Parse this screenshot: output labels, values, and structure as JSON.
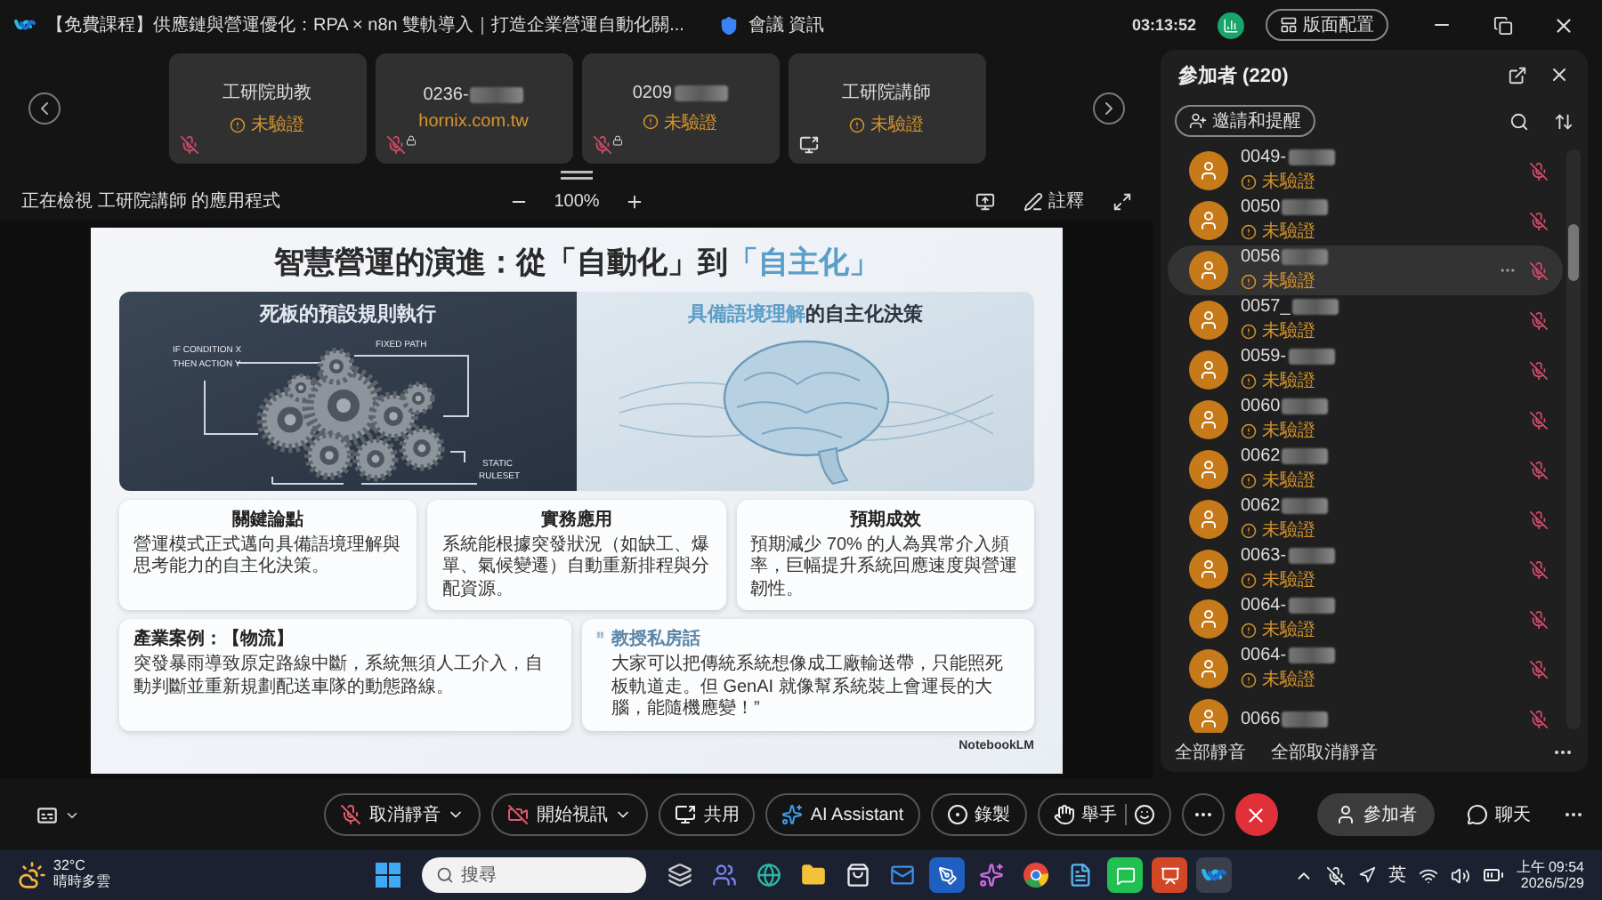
{
  "title_bar": {
    "title": "【免費課程】供應鏈與營運優化：RPA × n8n 雙軌導入｜打造企業營運自動化關...",
    "meeting_info": "會議 資訊",
    "timer": "03:13:52",
    "layout_button": "版面配置"
  },
  "video_tiles": [
    {
      "name": "工研院助教",
      "status": "未驗證",
      "blurred": false,
      "kind": "mic_off"
    },
    {
      "name": "0236-",
      "detail": "hornix.com.tw",
      "blurred": true,
      "kind": "mic_off_locked"
    },
    {
      "name": "0209",
      "status": "未驗證",
      "blurred": true,
      "kind": "mic_off_locked"
    },
    {
      "name": "工研院講師",
      "status": "未驗證",
      "blurred": false,
      "kind": "screen_share"
    }
  ],
  "share_bar": {
    "viewing": "正在檢視 工研院講師 的應用程式",
    "zoom": "100%",
    "annotate": "註釋"
  },
  "slide": {
    "title": "智慧營運的演進：從「自動化」到",
    "title_highlight": "「自主化」",
    "left_panel": {
      "heading": "死板的預設規則執行",
      "labels": [
        "IF CONDITION X",
        "THEN ACTION Y",
        "FIXED PATH",
        "STATIC",
        "RULESET"
      ]
    },
    "right_panel": {
      "heading_highlight": "具備語境理解",
      "heading_rest": "的自主化決策"
    },
    "cards": [
      {
        "title": "關鍵論點",
        "body": "營運模式正式邁向具備語境理解與思考能力的自主化決策。"
      },
      {
        "title": "實務應用",
        "body": "系統能根據突發狀況（如缺工、爆單、氣候變遷）自動重新排程與分配資源。"
      },
      {
        "title": "預期成效",
        "body": "預期減少 70% 的人為異常介入頻率，巨幅提升系統回應速度與營運韌性。"
      }
    ],
    "case": {
      "title": "產業案例：【物流】",
      "body": "突發暴雨導致原定路線中斷，系統無須人工介入，自動判斷並重新規劃配送車隊的動態路線。"
    },
    "quote": {
      "title": "教授私房話",
      "body": "大家可以把傳統系統想像成工廠輸送帶，只能照死板軌道走。但 GenAI 就像幫系統裝上會運長的大腦，能隨機應變！”"
    },
    "brand": "NotebookLM"
  },
  "participants_panel": {
    "title": "參加者 (220)",
    "invite_button": "邀請和提醒",
    "participants": [
      {
        "name": "0049-",
        "status": "未驗證",
        "selected": false,
        "blurred": true
      },
      {
        "name": "0050",
        "status": "未驗證",
        "selected": false,
        "blurred": true
      },
      {
        "name": "0056",
        "status": "未驗證",
        "selected": true,
        "blurred": true
      },
      {
        "name": "0057_",
        "status": "未驗證",
        "selected": false,
        "blurred": true
      },
      {
        "name": "0059-",
        "status": "未驗證",
        "selected": false,
        "blurred": true
      },
      {
        "name": "0060",
        "status": "未驗證",
        "selected": false,
        "blurred": true
      },
      {
        "name": "0062",
        "status": "未驗證",
        "selected": false,
        "blurred": true
      },
      {
        "name": "0062",
        "status": "未驗證",
        "selected": false,
        "blurred": true
      },
      {
        "name": "0063-",
        "status": "未驗證",
        "selected": false,
        "blurred": true
      },
      {
        "name": "0064-",
        "status": "未驗證",
        "selected": false,
        "blurred": true
      },
      {
        "name": "0064-",
        "status": "未驗證",
        "selected": false,
        "blurred": true
      },
      {
        "name": "0066",
        "selected": false,
        "blurred": true
      }
    ],
    "mute_all": "全部靜音",
    "unmute_all": "全部取消靜音"
  },
  "controls": {
    "center": [
      {
        "kind": "mute",
        "label": "取消靜音",
        "dropdown": true
      },
      {
        "kind": "video",
        "label": "開始視訊",
        "dropdown": true
      },
      {
        "kind": "share",
        "label": "共用",
        "dropdown": false
      },
      {
        "kind": "ai",
        "label": "AI Assistant",
        "dropdown": false
      },
      {
        "kind": "record",
        "label": "錄製",
        "dropdown": false
      },
      {
        "kind": "raise_hand",
        "label": "舉手",
        "dropdown": false
      },
      {
        "kind": "more"
      },
      {
        "kind": "leave"
      }
    ],
    "right": [
      {
        "kind": "participants",
        "label": "參加者",
        "selected": true
      },
      {
        "kind": "chat",
        "label": "聊天",
        "selected": false
      }
    ]
  },
  "taskbar": {
    "temperature": "32°C",
    "condition": "晴時多雲",
    "search_placeholder": "搜尋",
    "apps": [
      {
        "kind": "windows"
      },
      {
        "kind": "task_view"
      },
      {
        "kind": "teams"
      },
      {
        "kind": "edge"
      },
      {
        "kind": "explorer"
      },
      {
        "kind": "store"
      },
      {
        "kind": "mail"
      },
      {
        "kind": "editor"
      },
      {
        "kind": "copilot"
      },
      {
        "kind": "chrome"
      },
      {
        "kind": "notepad"
      },
      {
        "kind": "line"
      },
      {
        "kind": "powerpoint"
      },
      {
        "kind": "webex"
      }
    ],
    "language": "英",
    "time": "上午 09:54",
    "date": "2026/5/29"
  }
}
